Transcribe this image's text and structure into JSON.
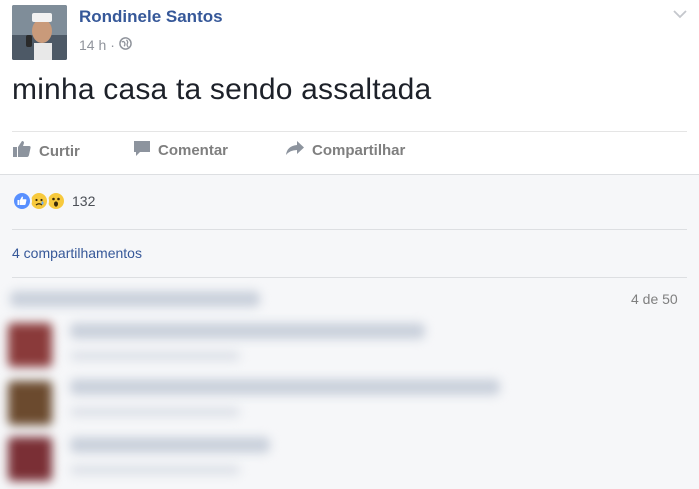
{
  "post": {
    "author": "Rondinele Santos",
    "time": "14 h",
    "separator": "·",
    "privacy_icon": "globe-icon",
    "text": "minha casa ta sendo assaltada"
  },
  "actions": {
    "like": "Curtir",
    "comment": "Comentar",
    "share": "Compartilhar"
  },
  "reactions": {
    "icons": [
      "like-reaction-icon",
      "sad-reaction-icon",
      "wow-reaction-icon"
    ],
    "count": "132"
  },
  "shares": {
    "label": "4 compartilhamentos"
  },
  "comments": {
    "pager": "4 de 50"
  },
  "colors": {
    "link": "#365899",
    "muted": "#90949c",
    "text": "#1d2129",
    "like_blue": "#5890ff",
    "emoji_yellow": "#f7c93d"
  }
}
